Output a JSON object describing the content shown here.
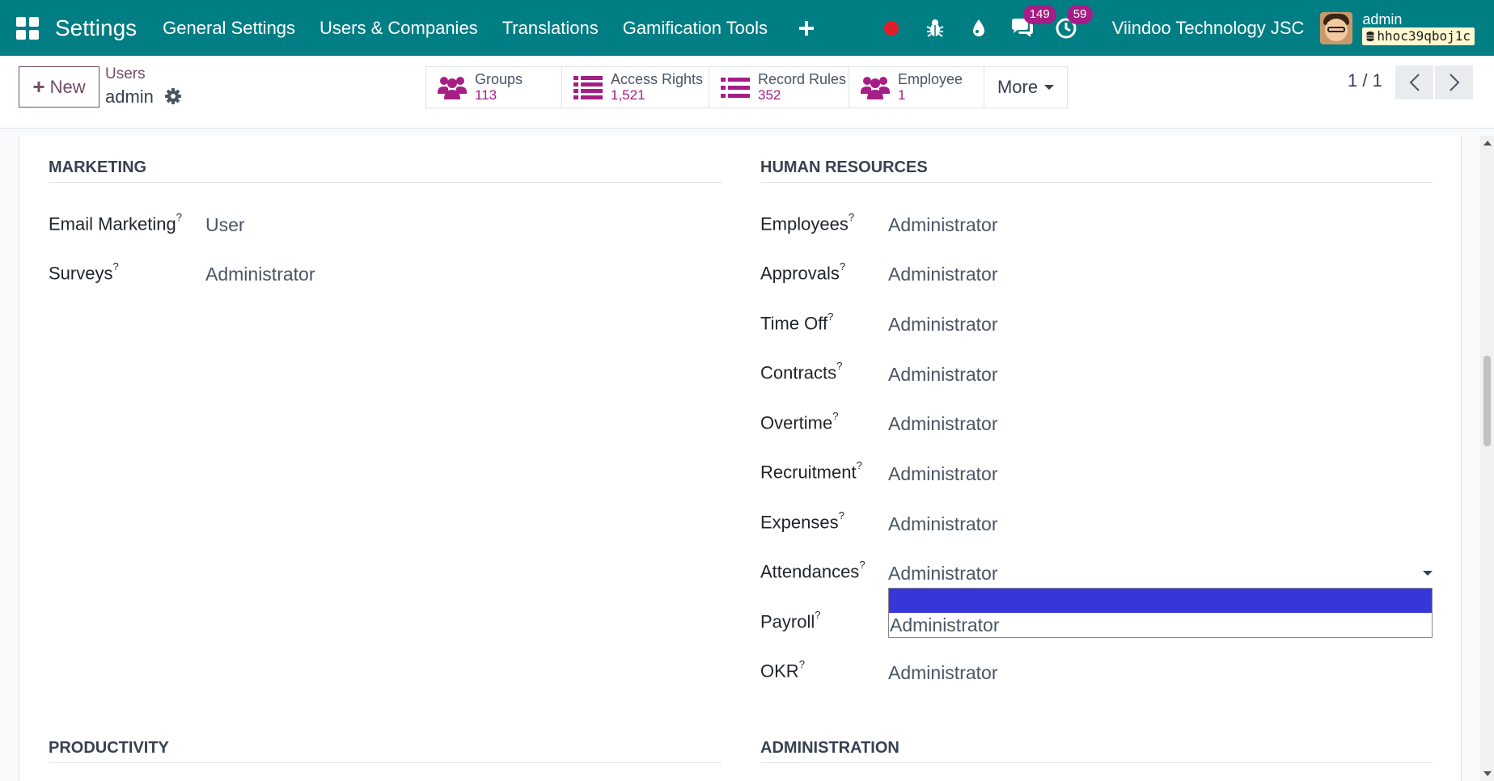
{
  "navbar": {
    "app_title": "Settings",
    "menu": [
      "General Settings",
      "Users & Companies",
      "Translations",
      "Gamification Tools"
    ],
    "messages_badge": "149",
    "activities_badge": "59",
    "company": "Viindoo Technology JSC",
    "user": "admin",
    "database": "hhoc39qboj1c",
    "accent": "#017e84"
  },
  "control": {
    "new_label": "New",
    "breadcrumb_parent": "Users",
    "breadcrumb_current": "admin",
    "smart_buttons": [
      {
        "label": "Groups",
        "value": "113",
        "icon": "users-icon"
      },
      {
        "label": "Access Rights",
        "value": "1,521",
        "icon": "list-icon"
      },
      {
        "label": "Record Rules",
        "value": "352",
        "icon": "list-icon"
      },
      {
        "label": "Employee",
        "value": "1",
        "icon": "users-icon"
      }
    ],
    "more_label": "More",
    "pager": "1 / 1"
  },
  "marketing": {
    "title": "MARKETING",
    "rows": [
      {
        "label": "Email Marketing",
        "value": "User"
      },
      {
        "label": "Surveys",
        "value": "Administrator"
      }
    ]
  },
  "human_resources": {
    "title": "HUMAN RESOURCES",
    "rows": [
      {
        "label": "Employees",
        "value": "Administrator"
      },
      {
        "label": "Approvals",
        "value": "Administrator"
      },
      {
        "label": "Time Off",
        "value": "Administrator"
      },
      {
        "label": "Contracts",
        "value": "Administrator"
      },
      {
        "label": "Overtime",
        "value": "Administrator"
      },
      {
        "label": "Recruitment",
        "value": "Administrator"
      },
      {
        "label": "Expenses",
        "value": "Administrator"
      },
      {
        "label": "Attendances",
        "value": "Administrator"
      },
      {
        "label": "Payroll",
        "value": ""
      },
      {
        "label": "OKR",
        "value": "Administrator"
      }
    ]
  },
  "dropdown": {
    "options": [
      "",
      "Administrator"
    ]
  },
  "productivity": {
    "title": "PRODUCTIVITY"
  },
  "administration": {
    "title": "ADMINISTRATION"
  },
  "help_mark": "?"
}
